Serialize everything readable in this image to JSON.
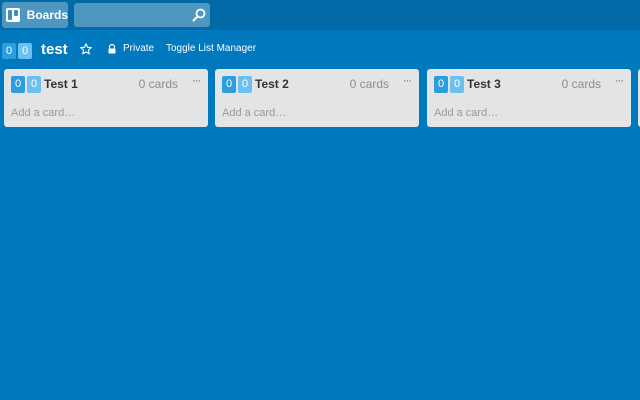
{
  "header": {
    "boards_label": "Boards",
    "search_placeholder": "",
    "board_title": "test",
    "board_badges": [
      "0",
      "0"
    ],
    "visibility": "Private",
    "toggle_label": "Toggle List Manager"
  },
  "lists": [
    {
      "badges": [
        "0",
        "0"
      ],
      "name": "Test 1",
      "count": "0 cards",
      "menu": "···",
      "add": "Add a card…"
    },
    {
      "badges": [
        "0",
        "0"
      ],
      "name": "Test 2",
      "count": "0 cards",
      "menu": "···",
      "add": "Add a card…"
    },
    {
      "badges": [
        "0",
        "0"
      ],
      "name": "Test 3",
      "count": "0 cards",
      "menu": "···",
      "add": "Add a card…"
    }
  ],
  "colors": {
    "board_bg": "#0079bf",
    "topbar_bg": "#026aa7",
    "list_bg": "#e2e4e6",
    "badge_dark": "#2c9ee0",
    "badge_light": "#6ac0ee"
  },
  "icons": {
    "logo": "trello-board-icon",
    "search": "search-icon",
    "star": "star-icon",
    "lock": "lock-icon",
    "menu": "ellipsis-icon"
  }
}
